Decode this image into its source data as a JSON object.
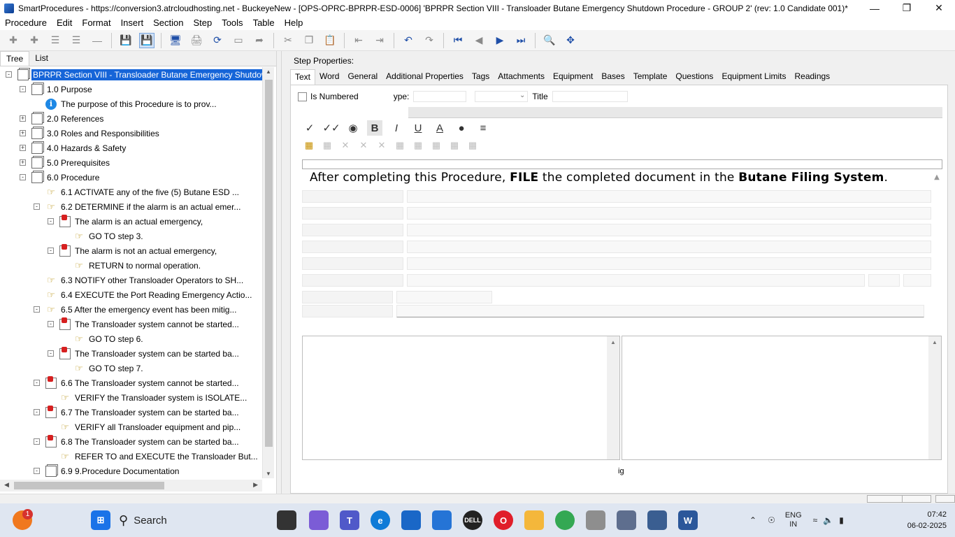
{
  "window": {
    "title": "SmartProcedures - https://conversion3.atrcloudhosting.net - BuckeyeNew - [OPS-OPRC-BPRPR-ESD-0006] 'BPRPR Section VIII - Transloader Butane Emergency Shutdown Procedure - GROUP 2' (rev: 1.0 Candidate 001)*"
  },
  "menu": [
    "Procedure",
    "Edit",
    "Format",
    "Insert",
    "Section",
    "Step",
    "Tools",
    "Table",
    "Help"
  ],
  "left_panel": {
    "tabs": [
      "Tree",
      "List"
    ],
    "tree": [
      {
        "label": "BPRPR Section VIII - Transloader Butane Emergency Shutdow...",
        "icon": "document-icon",
        "expander": "-",
        "level": 0,
        "selected": true
      },
      {
        "label": "1.0 Purpose",
        "icon": "document-icon",
        "expander": "-",
        "level": 1
      },
      {
        "label": "The purpose of this Procedure is to prov...",
        "icon": "info-icon",
        "expander": "",
        "level": 2
      },
      {
        "label": "2.0 References",
        "icon": "document-icon",
        "expander": "+",
        "level": 1
      },
      {
        "label": "3.0 Roles and Responsibilities",
        "icon": "document-icon",
        "expander": "+",
        "level": 1
      },
      {
        "label": "4.0 Hazards & Safety",
        "icon": "document-icon",
        "expander": "+",
        "level": 1
      },
      {
        "label": "5.0 Prerequisites",
        "icon": "document-icon",
        "expander": "+",
        "level": 1
      },
      {
        "label": "6.0 Procedure",
        "icon": "document-icon",
        "expander": "-",
        "level": 1
      },
      {
        "label": "6.1 ACTIVATE any of the five (5) Butane ESD ...",
        "icon": "hand-icon",
        "expander": "",
        "level": 2
      },
      {
        "label": "6.2 DETERMINE if the alarm is an actual emer...",
        "icon": "hand-icon",
        "expander": "-",
        "level": 2
      },
      {
        "label": "The alarm is an actual emergency,",
        "icon": "condition-icon",
        "expander": "-",
        "level": 3
      },
      {
        "label": "GO TO step 3.",
        "icon": "hand-icon",
        "expander": "",
        "level": 4
      },
      {
        "label": "The alarm is not an actual emergency,",
        "icon": "condition-icon",
        "expander": "-",
        "level": 3
      },
      {
        "label": "RETURN to normal operation.",
        "icon": "hand-icon",
        "expander": "",
        "level": 4
      },
      {
        "label": "6.3 NOTIFY other Transloader Operators to SH...",
        "icon": "hand-icon",
        "expander": "",
        "level": 2
      },
      {
        "label": "6.4 EXECUTE the Port Reading Emergency Actio...",
        "icon": "hand-icon",
        "expander": "",
        "level": 2
      },
      {
        "label": "6.5 After the emergency event has been mitig...",
        "icon": "hand-icon",
        "expander": "-",
        "level": 2
      },
      {
        "label": "The Transloader system cannot be started...",
        "icon": "condition-icon",
        "expander": "-",
        "level": 3
      },
      {
        "label": "GO TO step 6.",
        "icon": "hand-icon",
        "expander": "",
        "level": 4
      },
      {
        "label": "The Transloader system can be started ba...",
        "icon": "condition-icon",
        "expander": "-",
        "level": 3
      },
      {
        "label": "GO TO step 7.",
        "icon": "hand-icon",
        "expander": "",
        "level": 4
      },
      {
        "label": "6.6 The Transloader system cannot be started...",
        "icon": "condition-icon",
        "expander": "-",
        "level": 2
      },
      {
        "label": "VERIFY the Transloader system is ISOLATE...",
        "icon": "hand-icon",
        "expander": "",
        "level": 3
      },
      {
        "label": "6.7 The Transloader system can be started ba...",
        "icon": "condition-icon",
        "expander": "-",
        "level": 2
      },
      {
        "label": "VERIFY all Transloader equipment and pip...",
        "icon": "hand-icon",
        "expander": "",
        "level": 3
      },
      {
        "label": "6.8 The Transloader system can be started ba...",
        "icon": "condition-icon",
        "expander": "-",
        "level": 2
      },
      {
        "label": "REFER TO and EXECUTE the Transloader But...",
        "icon": "hand-icon",
        "expander": "",
        "level": 3
      },
      {
        "label": "6.9 9.Procedure Documentation",
        "icon": "document-icon",
        "expander": "-",
        "level": 2
      }
    ]
  },
  "step_properties": {
    "label": "Step Properties:",
    "tabs": [
      "Text",
      "Word",
      "General",
      "Additional Properties",
      "Tags",
      "Attachments",
      "Equipment",
      "Bases",
      "Template",
      "Questions",
      "Equipment Limits",
      "Readings"
    ],
    "active_tab": "Text",
    "is_numbered_label": "Is Numbered",
    "type_label": "ype:",
    "title_label": "Title",
    "step_text_parts": [
      {
        "text": "After completing this Procedure, ",
        "bold": false
      },
      {
        "text": "FILE",
        "bold": true
      },
      {
        "text": " the completed document in the ",
        "bold": false
      },
      {
        "text": "Butane Filing System",
        "bold": true
      },
      {
        "text": ".",
        "bold": false
      }
    ],
    "partial_label": "ig"
  },
  "taskbar": {
    "search_label": "Search",
    "notification_badge": "1",
    "lang_line1": "ENG",
    "lang_line2": "IN",
    "time": "07:42",
    "date": "06-02-2025"
  }
}
